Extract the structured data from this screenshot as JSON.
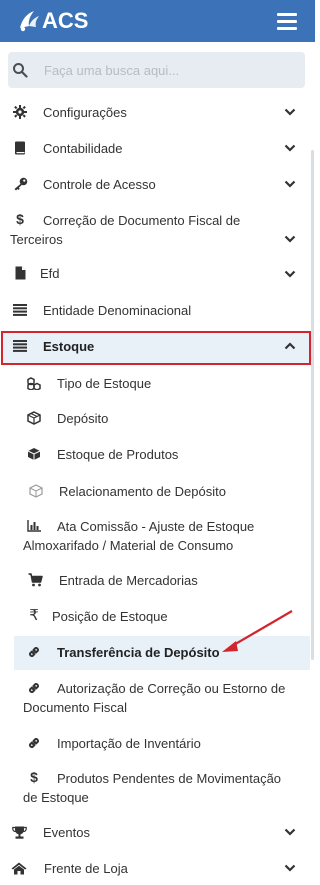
{
  "header": {
    "logo_text": "ACS"
  },
  "search": {
    "placeholder": "Faça uma busca aqui..."
  },
  "menu": {
    "items": [
      {
        "label": "Configurações",
        "icon": "gear-icon"
      },
      {
        "label": "Contabilidade",
        "icon": "book-icon"
      },
      {
        "label": "Controle de Acesso",
        "icon": "key-icon"
      },
      {
        "label": "Correção de Documento Fiscal de Terceiros",
        "icon": "dollar-icon"
      },
      {
        "label": "Efd",
        "icon": "file-icon"
      },
      {
        "label": "Entidade Denominacional",
        "icon": "list-icon"
      },
      {
        "label": "Estoque",
        "icon": "list-icon"
      },
      {
        "label": "Eventos",
        "icon": "trophy-icon"
      },
      {
        "label": "Frente de Loja",
        "icon": "home-icon"
      }
    ],
    "estoque_subitems": [
      {
        "label": "Tipo de Estoque",
        "icon": "cubes-icon"
      },
      {
        "label": "Depósito",
        "icon": "box-icon"
      },
      {
        "label": "Estoque de Produtos",
        "icon": "cube-icon"
      },
      {
        "label": "Relacionamento de Depósito",
        "icon": "box-outline-icon"
      },
      {
        "label": "Ata Comissão - Ajuste de Estoque Almoxarifado / Material de Consumo",
        "icon": "bar-chart-icon"
      },
      {
        "label": "Entrada de Mercadorias",
        "icon": "cart-icon"
      },
      {
        "label": "Posição de Estoque",
        "icon": "rupee-icon"
      },
      {
        "label": "Transferência de Depósito",
        "icon": "link-icon"
      },
      {
        "label": "Autorização de Correção ou Estorno de Documento Fiscal",
        "icon": "link-icon"
      },
      {
        "label": "Importação de Inventário",
        "icon": "link-icon"
      },
      {
        "label": "Produtos Pendentes de Movimentação de Estoque",
        "icon": "dollar-icon"
      }
    ]
  },
  "colors": {
    "header": "#3c73b8",
    "highlight_border": "#d3252e",
    "annotation_arrow": "#d3252e"
  }
}
